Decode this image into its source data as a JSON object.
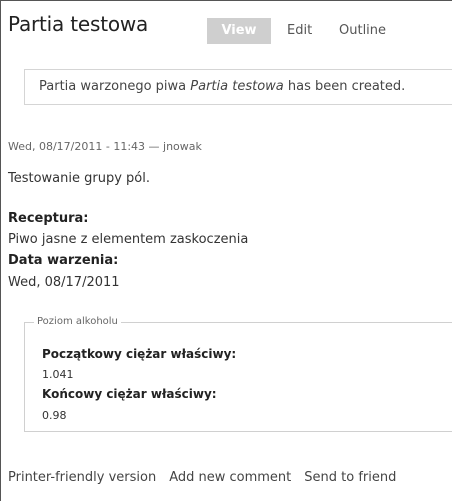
{
  "node": {
    "title": "Partia testowa",
    "tabs": [
      {
        "label": "View",
        "active": true
      },
      {
        "label": "Edit",
        "active": false
      },
      {
        "label": "Outline",
        "active": false
      }
    ]
  },
  "status_message": {
    "prefix": "Partia warzonego piwa ",
    "italic": "Partia testowa",
    "suffix": " has been created."
  },
  "submitted": "Wed, 08/17/2011 - 11:43 — jnowak",
  "body": "Testowanie grupy pól.",
  "fields": [
    {
      "label": "Receptura:",
      "value": "Piwo jasne z elementem zaskoczenia"
    },
    {
      "label": "Data warzenia:",
      "value": "Wed, 08/17/2011"
    }
  ],
  "fieldset": {
    "legend": "Poziom alkoholu",
    "items": [
      {
        "label": "Początkowy ciężar właściwy:",
        "value": "1.041"
      },
      {
        "label": "Końcowy ciężar właściwy:",
        "value": "0.98"
      }
    ]
  },
  "links": [
    "Printer-friendly version",
    "Add new comment",
    "Send to friend"
  ]
}
